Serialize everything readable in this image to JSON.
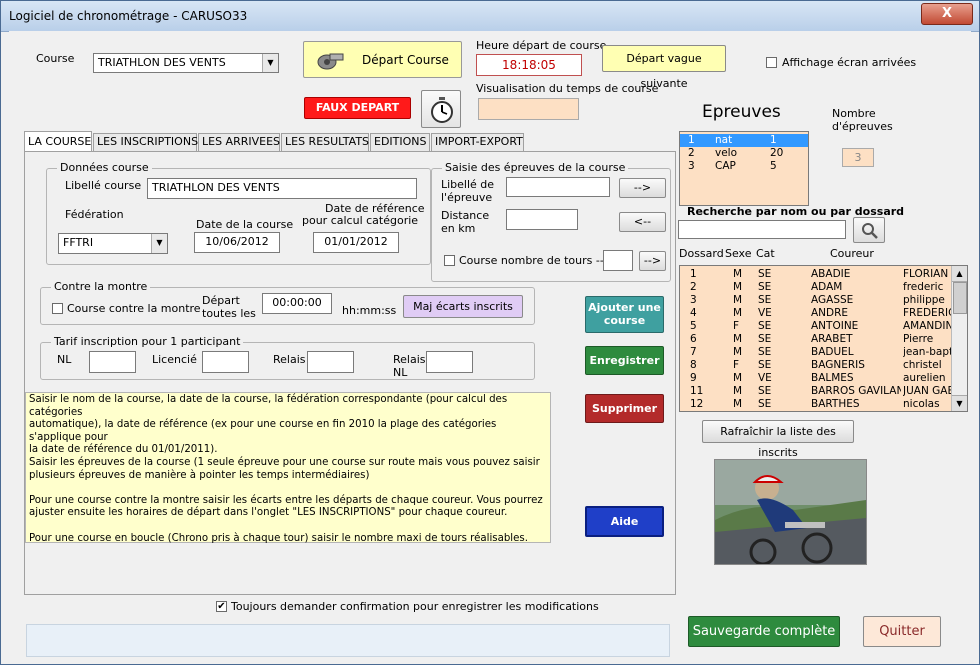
{
  "window": {
    "title": "Logiciel de chronométrage - CARUSO33",
    "close_label": "X"
  },
  "header": {
    "course_label": "Course",
    "course_value": "TRIATHLON DES VENTS",
    "depart_button": "Départ Course",
    "heure_label": "Heure départ de course",
    "heure_value": "18:18:05",
    "depart_vague_button": "Départ vague suivante",
    "affichage_label": "Affichage écran arrivées",
    "faux_depart_button": "FAUX DEPART",
    "visualisation_label": "Visualisation du temps de course",
    "visualisation_value": ""
  },
  "tabs": [
    {
      "label": "LA COURSE"
    },
    {
      "label": "LES INSCRIPTIONS"
    },
    {
      "label": "LES ARRIVEES"
    },
    {
      "label": "LES RESULTATS"
    },
    {
      "label": "EDITIONS"
    },
    {
      "label": "IMPORT-EXPORT"
    }
  ],
  "donnees": {
    "title": "Données course",
    "libelle_label": "Libellé course",
    "libelle_value": "TRIATHLON DES VENTS",
    "federation_label": "Fédération",
    "federation_value": "FFTRI",
    "date_course_label": "Date de la course",
    "date_course_value": "10/06/2012",
    "date_ref_label_1": "Date de référence",
    "date_ref_label_2": "pour calcul catégorie",
    "date_ref_value": "01/01/2012"
  },
  "saisie": {
    "title": "Saisie des épreuves de la course",
    "libelle_label_1": "Libellé de",
    "libelle_label_2": "l'épreuve",
    "libelle_value": "",
    "add_button": "-->",
    "distance_label_1": "Distance",
    "distance_label_2": "en km",
    "distance_value": "",
    "remove_button": "<--",
    "tours_label": "Course nombre de tours -->",
    "tours_value": "",
    "tours_button": "-->"
  },
  "montre": {
    "title": "Contre la montre",
    "checkbox_label": "Course contre la montre",
    "depart_label_1": "Départ",
    "depart_label_2": "toutes les",
    "depart_value": "00:00:00",
    "format_label": "hh:mm:ss",
    "maj_button": "Maj écarts inscrits"
  },
  "tarif": {
    "title": "Tarif inscription pour 1 participant",
    "nl_label": "NL",
    "licencie_label": "Licencié",
    "relais_label": "Relais",
    "relais_nl_label_1": "Relais",
    "relais_nl_label_2": "NL"
  },
  "actions": {
    "ajouter_1": "Ajouter une",
    "ajouter_2": "course",
    "enregistrer": "Enregistrer",
    "supprimer": "Supprimer",
    "aide": "Aide"
  },
  "help_lines": [
    "Saisir le nom de la course, la date de la course, la fédération correspondante (pour calcul des catégories",
    "automatique), la  date de référence (ex pour une course en fin 2010 la plage des catégories s'applique pour",
    "la date de référence du 01/01/2011).",
    "Saisir les épreuves de la course (1 seule épreuve pour une course sur route mais vous pouvez saisir",
    "plusieurs épreuves de manière à pointer les temps intermédiaires)",
    "",
    "Pour une course contre la montre saisir les écarts entre les départs de chaque coureur. Vous pourrez",
    "ajuster ensuite les horaires de départ dans l'onglet \"LES INSCRIPTIONS\" pour chaque coureur.",
    "",
    "Pour une course en boucle (Chrono pris à chaque tour) saisir le nombre maxi de tours réalisables."
  ],
  "confirm_label": "Toujours demander confirmation pour enregistrer les modifications",
  "epreuves": {
    "title": "Epreuves",
    "nombre_label_1": "Nombre",
    "nombre_label_2": "d'épreuves",
    "nombre_value": "3",
    "rows": [
      {
        "num": "1",
        "name": "nat",
        "dist": "1"
      },
      {
        "num": "2",
        "name": "velo",
        "dist": "20"
      },
      {
        "num": "3",
        "name": "CAP",
        "dist": "5"
      }
    ]
  },
  "recherche": {
    "title": "Recherche par nom ou par dossard",
    "value": ""
  },
  "inscrits": {
    "headers": {
      "dossard": "Dossard",
      "sexe": "Sexe",
      "cat": "Cat",
      "coureur": "Coureur"
    },
    "rows": [
      {
        "dossard": "1",
        "sexe": "M",
        "cat": "SE",
        "nom": "ABADIE",
        "prenom": "FLORIAN"
      },
      {
        "dossard": "2",
        "sexe": "M",
        "cat": "SE",
        "nom": "ADAM",
        "prenom": "frederic"
      },
      {
        "dossard": "3",
        "sexe": "M",
        "cat": "SE",
        "nom": "AGASSE",
        "prenom": "philippe"
      },
      {
        "dossard": "4",
        "sexe": "M",
        "cat": "VE",
        "nom": "ANDRE",
        "prenom": "FREDERIC"
      },
      {
        "dossard": "5",
        "sexe": "F",
        "cat": "SE",
        "nom": "ANTOINE",
        "prenom": "AMANDINE"
      },
      {
        "dossard": "6",
        "sexe": "M",
        "cat": "SE",
        "nom": "ARABET",
        "prenom": "Pierre"
      },
      {
        "dossard": "7",
        "sexe": "M",
        "cat": "SE",
        "nom": "BADUEL",
        "prenom": "jean-bapt"
      },
      {
        "dossard": "8",
        "sexe": "F",
        "cat": "SE",
        "nom": "BAGNERIS",
        "prenom": "christel"
      },
      {
        "dossard": "9",
        "sexe": "M",
        "cat": "VE",
        "nom": "BALMES",
        "prenom": "aurelien"
      },
      {
        "dossard": "11",
        "sexe": "M",
        "cat": "SE",
        "nom": "BARROS GAVILAN",
        "prenom": "JUAN GAB"
      },
      {
        "dossard": "12",
        "sexe": "M",
        "cat": "SE",
        "nom": "BARTHES",
        "prenom": "nicolas"
      }
    ],
    "refresh_button": "Rafraîchir la liste des inscrits"
  },
  "footer": {
    "sauvegarde_button": "Sauvegarde complète",
    "quitter_button": "Quitter",
    "status_text": ""
  },
  "colors": {
    "accent_blue": "#3399ff",
    "yellow_button": "#ffffb3",
    "red_button": "#ff1a1a",
    "teal_button": "#3fa0a0",
    "green_button": "#2e8b3e",
    "dark_red_button": "#b32a2a",
    "blue_button": "#1f3fc8",
    "peach_field": "#fde0c4",
    "help_yellow": "#ffffcc"
  }
}
